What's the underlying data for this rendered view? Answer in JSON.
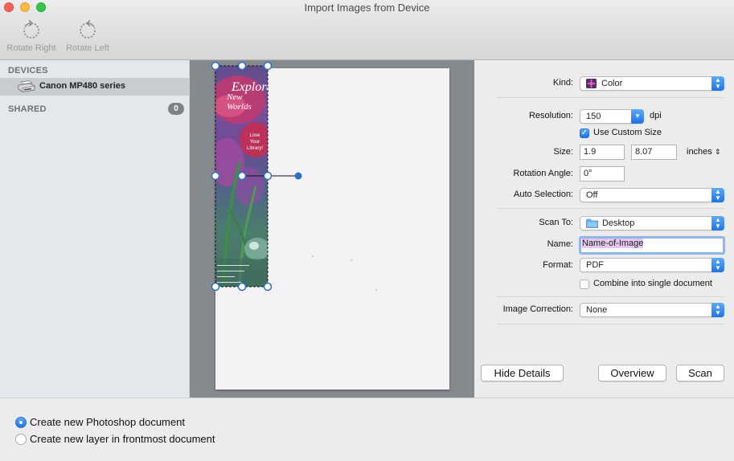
{
  "window": {
    "title": "Import Images from Device"
  },
  "toolbar": {
    "rotate_right_label": "Rotate Right",
    "rotate_left_label": "Rotate Left"
  },
  "sidebar": {
    "devices_header": "DEVICES",
    "device_name": "Canon MP480 series",
    "shared_header": "SHARED",
    "shared_count": "0"
  },
  "preview": {
    "scan_title_line1": "Explore",
    "scan_title_line2": "New Worlds",
    "scan_text": "Love Your Library!"
  },
  "settings": {
    "kind_label": "Kind:",
    "kind_value": "Color",
    "resolution_label": "Resolution:",
    "resolution_value": "150",
    "resolution_unit": "dpi",
    "custom_size_label": "Use Custom Size",
    "custom_size_checked": true,
    "size_label": "Size:",
    "size_width": "1.9",
    "size_height": "8.07",
    "size_unit": "inches",
    "rotation_label": "Rotation Angle:",
    "rotation_value": "0°",
    "auto_selection_label": "Auto Selection:",
    "auto_selection_value": "Off",
    "scan_to_label": "Scan To:",
    "scan_to_value": "Desktop",
    "name_label": "Name:",
    "name_value": "Name-of-Image",
    "format_label": "Format:",
    "format_value": "PDF",
    "combine_label": "Combine into single document",
    "combine_checked": false,
    "image_correction_label": "Image Correction:",
    "image_correction_value": "None"
  },
  "buttons": {
    "hide_details": "Hide Details",
    "overview": "Overview",
    "scan": "Scan"
  },
  "options": {
    "new_document_label": "Create new Photoshop document",
    "new_layer_label": "Create new layer in frontmost document",
    "selected": "new_document"
  },
  "colors": {
    "accent": "#1f74e6",
    "sidebar_bg": "#e3e8ec",
    "preview_bg": "#858a8e"
  }
}
